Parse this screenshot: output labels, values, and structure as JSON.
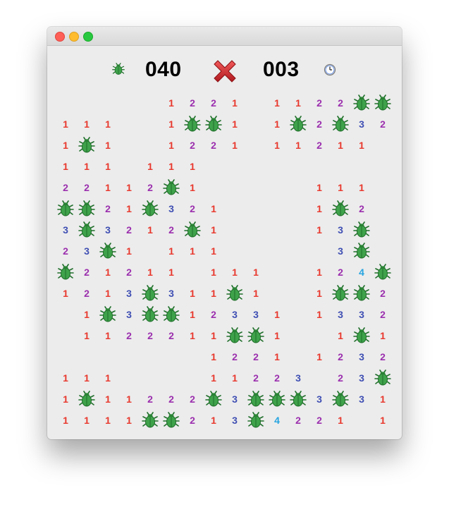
{
  "window": {
    "traffic_lights": [
      "close-button",
      "minimize-button",
      "zoom-button"
    ]
  },
  "header": {
    "mines_remaining": "040",
    "timer": "003",
    "mine_icon": "bug-icon",
    "face_icon": "red-x-icon",
    "timer_icon": "clock-icon"
  },
  "colors": {
    "1": "#e8382d",
    "2": "#9b2fae",
    "3": "#3f4fb3",
    "4": "#26a4e0",
    "bug_body": "#3ea24a",
    "bug_dark": "#1f6e2a",
    "x_red": "#d2232a"
  },
  "board": {
    "columns": 16,
    "rows": 16,
    "legend": "' '=opened empty, digit=adjacent mine count, B=bug mine, R=rocket",
    "rows_data": [
      "     1221 1122BB",
      "111  1BB1 1B2B32",
      "1B1  1221 11211 ",
      "111 111         ",
      "22112B1     111 ",
      "BB21B321    1B2 ",
      "3B3212B1    13B ",
      "23B1 111     3B ",
      "B21211 111  124B",
      "1213B311B1  1BB2",
      " 1B3BB12331 1332",
      " 1122211BB1  1B1",
      "       1221 1232",
      "111    11223 23B",
      "1B11222B3BBB3B31",
      "1111BB213B4221 1"
    ]
  }
}
